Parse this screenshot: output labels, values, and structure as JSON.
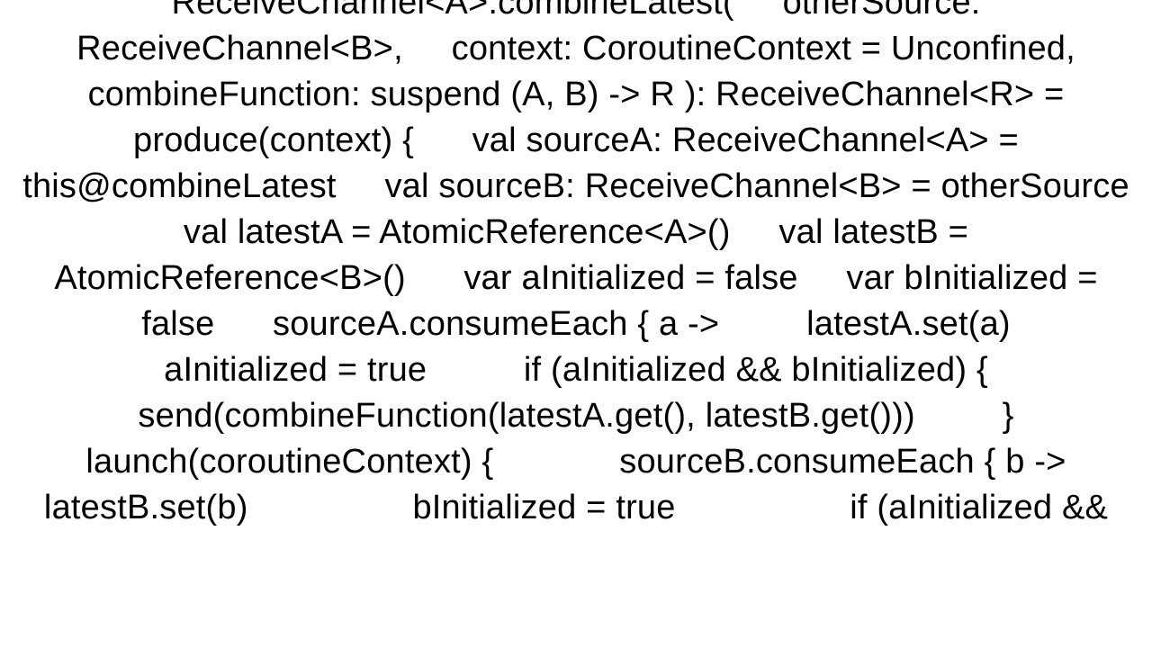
{
  "code_text": "ReceiveChannel<A>.combineLatest(     otherSource: ReceiveChannel<B>,     context: CoroutineContext = Unconfined,     combineFunction: suspend (A, B) -> R ): ReceiveChannel<R> = produce(context) {      val sourceA: ReceiveChannel<A> = this@combineLatest     val sourceB: ReceiveChannel<B> = otherSource      val latestA = AtomicReference<A>()     val latestB = AtomicReference<B>()      var aInitialized = false     var bInitialized = false      sourceA.consumeEach { a ->         latestA.set(a)         aInitialized = true          if (aInitialized && bInitialized) {             send(combineFunction(latestA.get(), latestB.get()))         }          launch(coroutineContext) {             sourceB.consumeEach { b ->                 latestB.set(b)                 bInitialized = true                  if (aInitialized &&"
}
